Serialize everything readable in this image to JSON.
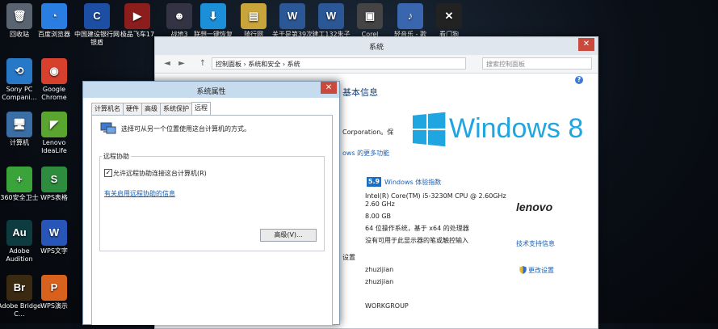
{
  "desktop": {
    "icons": [
      {
        "label": "回收站",
        "glyph": "🗑",
        "color": "#5a6470",
        "icon": "recycle-bin-icon"
      },
      {
        "label": "百度浏览器",
        "glyph": "◔",
        "color": "#2a7de1",
        "icon": "baidu-browser-icon"
      },
      {
        "label": "中国建设银行网银盾",
        "glyph": "C",
        "color": "#1c4fa3",
        "icon": "ccb-icon"
      },
      {
        "label": "极品飞车17",
        "glyph": "▶",
        "color": "#8c1d1d",
        "icon": "nfs-icon"
      },
      {
        "label": "战地3",
        "glyph": "☻",
        "color": "#334",
        "icon": "battlefield-icon"
      },
      {
        "label": "联想一键恢复",
        "glyph": "⬇",
        "color": "#1b8fd8",
        "icon": "lenovo-recovery-icon"
      },
      {
        "label": "骑行网",
        "glyph": "▤",
        "color": "#c9a43a",
        "icon": "folder-icon"
      },
      {
        "label": "关于是第39次",
        "glyph": "W",
        "color": "#2b5797",
        "icon": "word-doc-icon"
      },
      {
        "label": "建工132朱子",
        "glyph": "W",
        "color": "#2b5797",
        "icon": "word-doc-icon"
      },
      {
        "label": "Corel",
        "glyph": "▣",
        "color": "#444",
        "icon": "corel-icon"
      },
      {
        "label": "轻音乐 - 歌",
        "glyph": "♪",
        "color": "#3a66b0",
        "icon": "mp3-icon"
      },
      {
        "label": "看门狗",
        "glyph": "✕",
        "color": "#222",
        "icon": "watchdogs-icon"
      },
      {
        "label": "Sony PC Compani…",
        "glyph": "⟲",
        "color": "#2878c8",
        "icon": "sony-icon"
      },
      {
        "label": "Google Chrome",
        "glyph": "◉",
        "color": "#d8402e",
        "icon": "chrome-icon"
      },
      {
        "label": "计算机",
        "glyph": "🖥",
        "color": "#3a6ea5",
        "icon": "computer-icon"
      },
      {
        "label": "Lenovo IdeaLife",
        "glyph": "◤",
        "color": "#5aa530",
        "icon": "idealife-icon"
      },
      {
        "label": "360安全卫士",
        "glyph": "+",
        "color": "#3aa33a",
        "icon": "360-icon"
      },
      {
        "label": "WPS表格",
        "glyph": "S",
        "color": "#2e8c3e",
        "icon": "wps-sheet-icon"
      },
      {
        "label": "Adobe Audition",
        "glyph": "Au",
        "color": "#0d3b3f",
        "icon": "audition-icon"
      },
      {
        "label": "WPS文字",
        "glyph": "W",
        "color": "#2756b8",
        "icon": "wps-writer-icon"
      },
      {
        "label": "Adobe Bridge C…",
        "glyph": "Br",
        "color": "#3b2a12",
        "icon": "bridge-icon"
      },
      {
        "label": "WPS演示",
        "glyph": "P",
        "color": "#d9611e",
        "icon": "wps-present-icon"
      }
    ]
  },
  "system_window": {
    "title": "系统",
    "close": "✕",
    "nav_back": "◄",
    "nav_forward": "►",
    "nav_up": "↑",
    "address": "控制面板 › 系统和安全 › 系统",
    "search_placeholder": "搜索控制面板",
    "help": "?",
    "header_partial": "基本信息",
    "edition_partial": "Corporation。保",
    "more_features_partial": "ows 的更多功能",
    "windows_logo_text": "Windows 8",
    "score": "5.9",
    "score_link": "Windows 体验指数",
    "processor": "Intel(R) Core(TM) i5-3230M CPU @ 2.60GHz",
    "speed": "2.60 GHz",
    "memory": "8.00 GB",
    "system_type": "64 位操作系统，基于 x64 的处理器",
    "pen_touch": "没有可用于此显示器的笔或触控输入",
    "support_link": "技术支持信息",
    "brand": "lenovo",
    "settings_partial": "设置",
    "computer_name": "zhuzijian",
    "full_name": "zhuzijian",
    "change_settings": "更改设置",
    "workgroup": "WORKGROUP"
  },
  "properties_dialog": {
    "title": "系统属性",
    "close": "✕",
    "tabs": [
      "计算机名",
      "硬件",
      "高级",
      "系统保护",
      "远程"
    ],
    "description": "选择可从另一个位置使用这台计算机的方式。",
    "group_label": "远程协助",
    "checkbox_label": "允许远程协助连接这台计算机(R)",
    "checkbox_checked": "✓",
    "help_link": "有关启用远程协助的信息",
    "advanced_button": "高级(V)..."
  }
}
